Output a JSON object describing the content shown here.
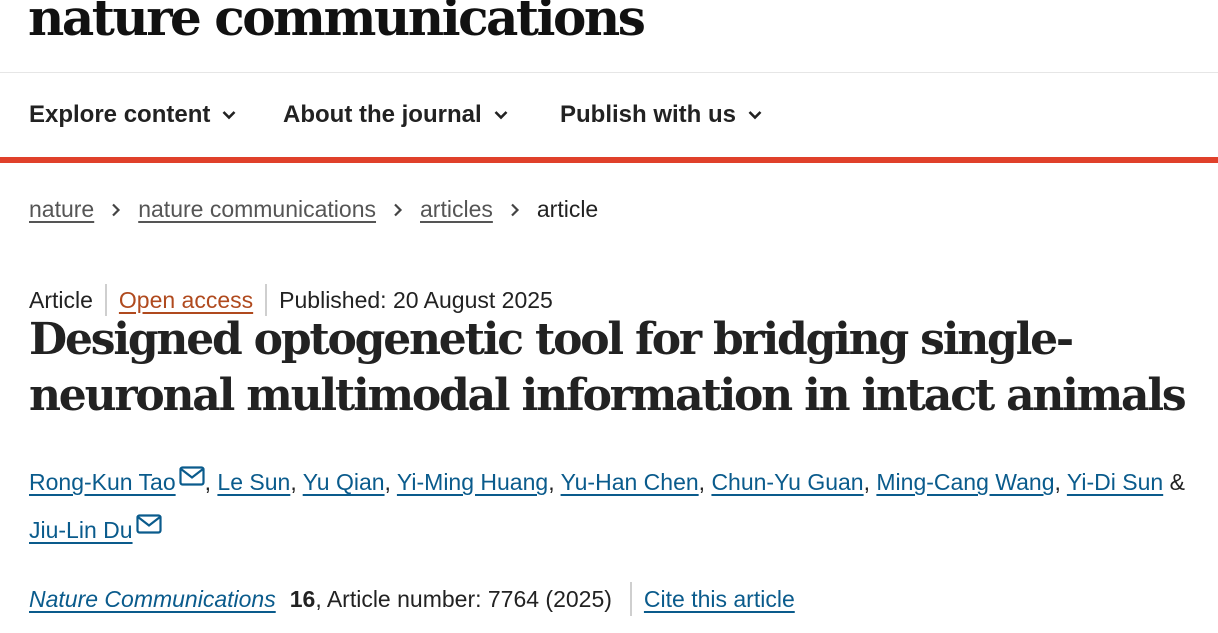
{
  "header": {
    "logo_text": "nature communications"
  },
  "nav": {
    "items": [
      {
        "label": "Explore content",
        "icon": "chevron-down-icon"
      },
      {
        "label": "About the journal",
        "icon": "chevron-down-icon"
      },
      {
        "label": "Publish with us",
        "icon": "chevron-down-icon"
      }
    ],
    "accent_color": "#e0402a"
  },
  "breadcrumb": {
    "items": [
      "nature",
      "nature communications",
      "articles"
    ],
    "current": "article"
  },
  "article": {
    "type": "Article",
    "access": "Open access",
    "published": "Published: 20 August 2025",
    "title": "Designed optogenetic tool for bridging single-neuronal multimodal information in intact animals",
    "authors": [
      {
        "name": "Rong-Kun Tao",
        "sep": ", "
      },
      {
        "name": "Le Sun",
        "sep": ", "
      },
      {
        "name": "Yu Qian",
        "sep": ", "
      },
      {
        "name": "Yi-Ming Huang",
        "sep": ", "
      },
      {
        "name": "Yu-Han Chen",
        "sep": ", "
      },
      {
        "name": "Chun-Yu Guan",
        "sep": ", "
      },
      {
        "name": "Ming-Cang Wang",
        "sep": ", "
      },
      {
        "name": "Yi-Di Sun",
        "sep": " & "
      },
      {
        "name": "Jiu-Lin Du",
        "sep": ""
      }
    ],
    "journal": "Nature Communications",
    "volume": "16",
    "article_number": ", Article number: 7764 (2025)",
    "cite_label": "Cite this article",
    "link_color": "#0a5b8c",
    "open_access_color": "#b04a1e"
  }
}
